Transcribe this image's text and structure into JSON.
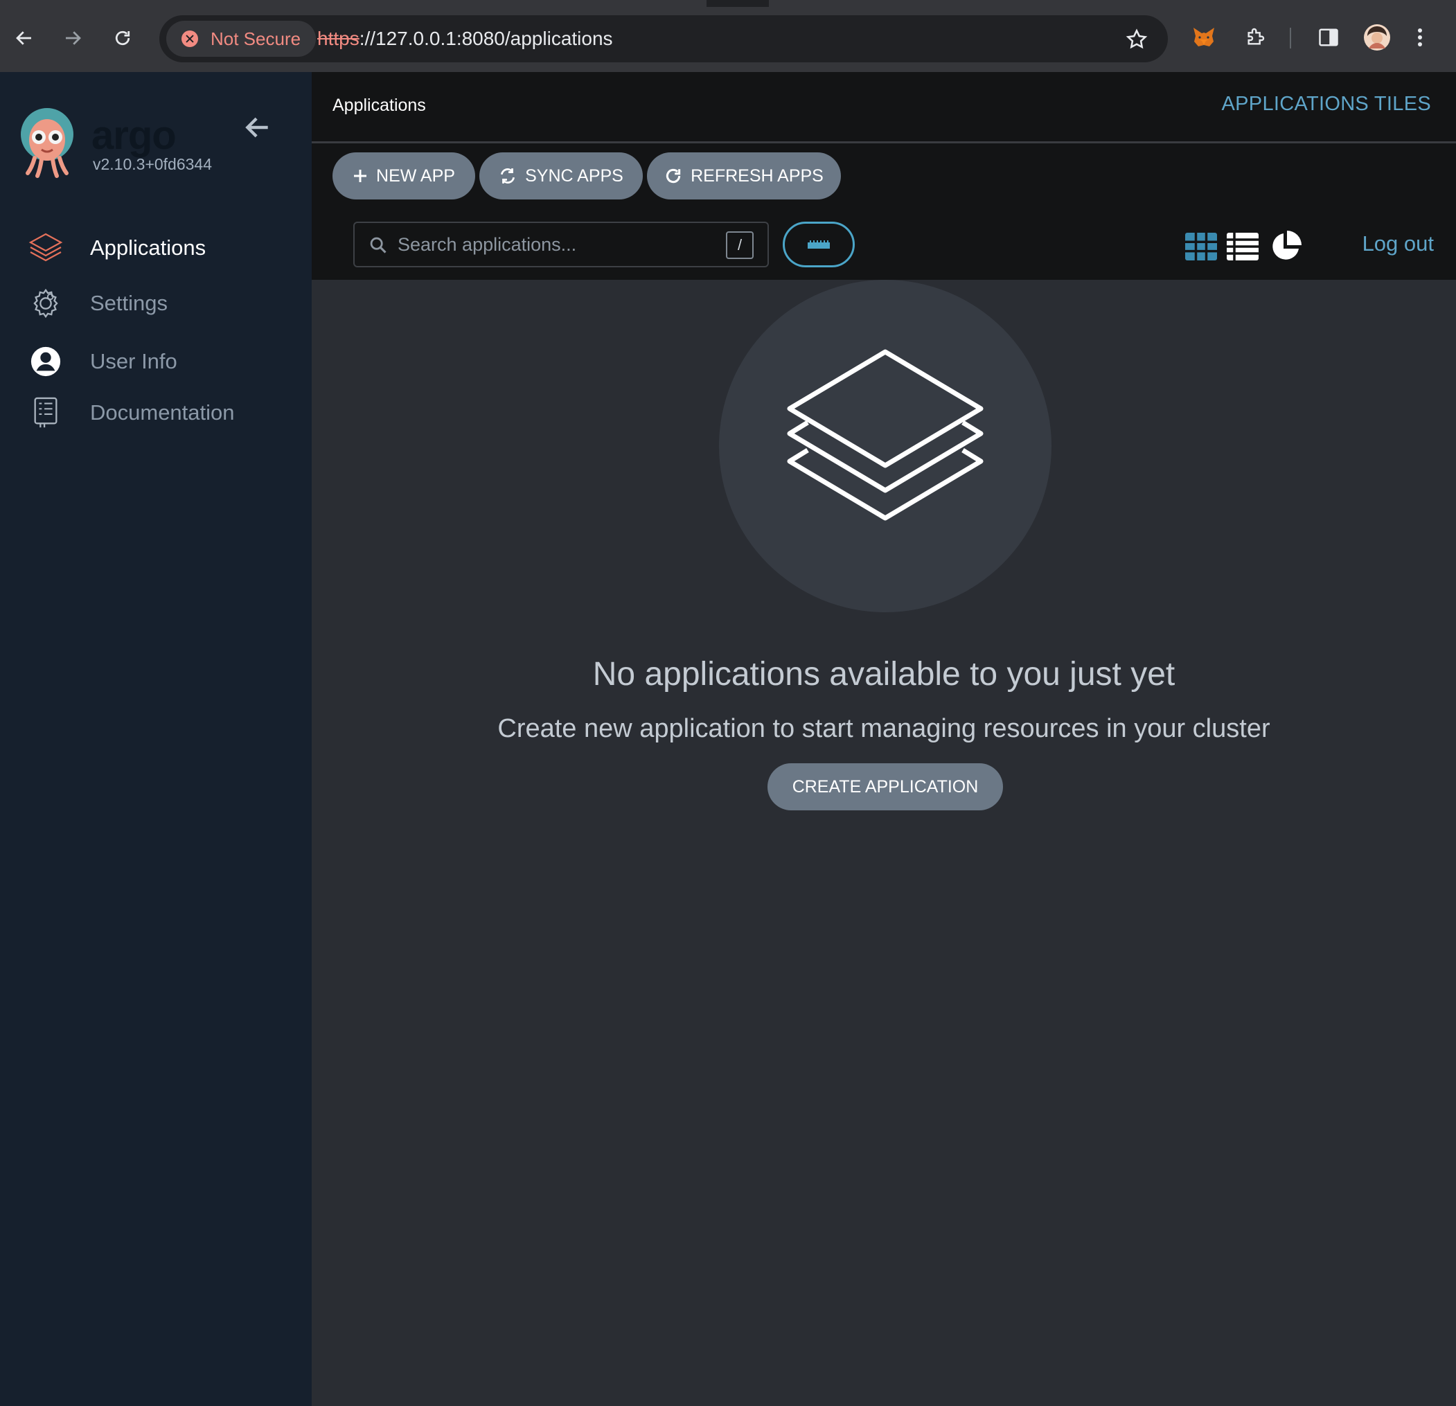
{
  "browser": {
    "security_label": "Not Secure",
    "url_scheme": "https",
    "url_rest": "://127.0.0.1:8080/applications",
    "icons": [
      "back-arrow-icon",
      "forward-arrow-icon",
      "reload-icon",
      "bookmark-star-icon",
      "metamask-fox-icon",
      "extensions-puzzle-icon",
      "side-panel-icon",
      "profile-avatar-icon",
      "menu-kebab-icon"
    ]
  },
  "sidebar": {
    "brand": "argo",
    "version": "v2.10.3+0fd6344",
    "items": [
      {
        "label": "Applications",
        "icon": "layers-icon",
        "active": true
      },
      {
        "label": "Settings",
        "icon": "gear-icon",
        "active": false
      },
      {
        "label": "User Info",
        "icon": "user-circle-icon",
        "active": false
      },
      {
        "label": "Documentation",
        "icon": "book-icon",
        "active": false
      }
    ]
  },
  "header": {
    "page_title": "Applications",
    "view_title": "APPLICATIONS TILES"
  },
  "toolbar": {
    "new_app": "NEW APP",
    "sync_apps": "SYNC APPS",
    "refresh_apps": "REFRESH APPS",
    "search_placeholder": "Search applications...",
    "search_shortcut": "/",
    "logout": "Log out"
  },
  "empty_state": {
    "title": "No applications available to you just yet",
    "subtitle": "Create new application to start managing resources in your cluster",
    "create_button": "CREATE APPLICATION"
  },
  "colors": {
    "accent": "#5fa5c9",
    "sidebar_bg": "#16202d",
    "button_bg": "#6b7886",
    "content_bg": "#2a2d33"
  }
}
